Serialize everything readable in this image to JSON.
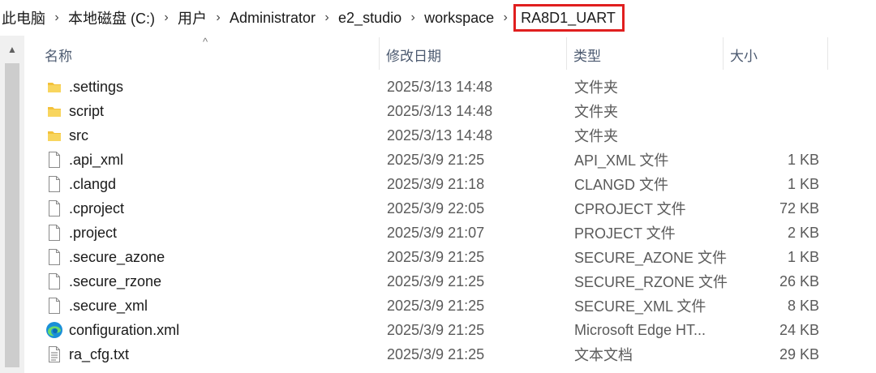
{
  "breadcrumb": {
    "items": [
      "此电脑",
      "本地磁盘 (C:)",
      "用户",
      "Administrator",
      "e2_studio",
      "workspace",
      "RA8D1_UART"
    ],
    "separator": "›",
    "highlight_color": "#e01f1f"
  },
  "columns": {
    "name": "名称",
    "date": "修改日期",
    "type": "类型",
    "size": "大小",
    "sort_indicator": "^"
  },
  "files": [
    {
      "icon": "folder-icon",
      "name": ".settings",
      "date": "2025/3/13 14:48",
      "type": "文件夹",
      "size": ""
    },
    {
      "icon": "folder-icon",
      "name": "script",
      "date": "2025/3/13 14:48",
      "type": "文件夹",
      "size": ""
    },
    {
      "icon": "folder-icon",
      "name": "src",
      "date": "2025/3/13 14:48",
      "type": "文件夹",
      "size": ""
    },
    {
      "icon": "file-icon",
      "name": ".api_xml",
      "date": "2025/3/9 21:25",
      "type": "API_XML 文件",
      "size": "1 KB"
    },
    {
      "icon": "file-icon",
      "name": ".clangd",
      "date": "2025/3/9 21:18",
      "type": "CLANGD 文件",
      "size": "1 KB"
    },
    {
      "icon": "file-icon",
      "name": ".cproject",
      "date": "2025/3/9 22:05",
      "type": "CPROJECT 文件",
      "size": "72 KB"
    },
    {
      "icon": "file-icon",
      "name": ".project",
      "date": "2025/3/9 21:07",
      "type": "PROJECT 文件",
      "size": "2 KB"
    },
    {
      "icon": "file-icon",
      "name": ".secure_azone",
      "date": "2025/3/9 21:25",
      "type": "SECURE_AZONE 文件",
      "size": "1 KB"
    },
    {
      "icon": "file-icon",
      "name": ".secure_rzone",
      "date": "2025/3/9 21:25",
      "type": "SECURE_RZONE 文件",
      "size": "26 KB"
    },
    {
      "icon": "file-icon",
      "name": ".secure_xml",
      "date": "2025/3/9 21:25",
      "type": "SECURE_XML 文件",
      "size": "8 KB"
    },
    {
      "icon": "edge-icon",
      "name": "configuration.xml",
      "date": "2025/3/9 21:25",
      "type": "Microsoft Edge HT...",
      "size": "24 KB"
    },
    {
      "icon": "text-file-icon",
      "name": "ra_cfg.txt",
      "date": "2025/3/9 21:25",
      "type": "文本文档",
      "size": "29 KB"
    }
  ]
}
